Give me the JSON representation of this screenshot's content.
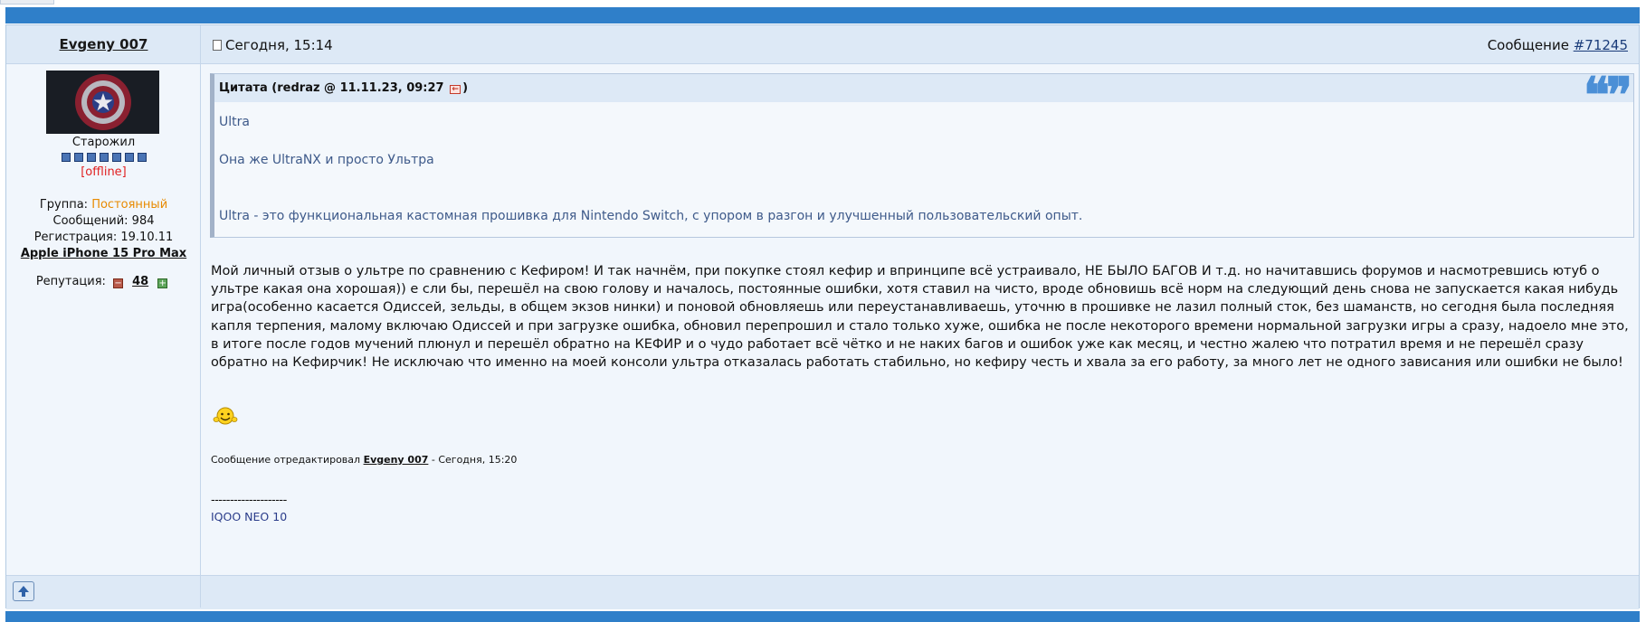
{
  "post": {
    "author": "Evgeny 007",
    "date": "Сегодня, 15:14",
    "post_prefix": "Сообщение ",
    "post_number": "#71245",
    "rank": "Старожил",
    "pip_count": 7,
    "status": "[offline]",
    "group_label": "Группа: ",
    "group_value": "Постоянный",
    "messages": "Сообщений: 984",
    "registration": "Регистрация: 19.10.11",
    "device": "Apple iPhone 15 Pro Max",
    "reputation_label": "Репутация:",
    "reputation_value": "48"
  },
  "quote": {
    "title_prefix": "Цитата (redraz @ 11.11.23, 09:27 ",
    "title_suffix": ")",
    "mark": "❝",
    "lines": [
      "Ultra",
      "Она же UltraNX и просто Ультра",
      "Ultra - это функциональная кастомная прошивка для Nintendo Switch, с упором в разгон и улучшенный пользовательский опыт."
    ]
  },
  "body_text": "Мой личный отзыв о ультре по сравнению с Кефиром! И так начнём, при покупке стоял кефир и впринципе всё устраивало, НЕ БЫЛО БАГОВ И т.д. но начитавшись форумов и насмотревшись ютуб о ультре какая она хорошая)) е сли бы, перешёл на свою голову и началось, постоянные ошибки, хотя ставил на чисто, вроде обновишь всё норм на следующий день снова не запускается какая нибудь игра(особенно касается Одиссей, зельды, в общем экзов нинки) и поновой обновляешь или переустанавливаешь, уточню в прошивке не лазил полный сток, без шаманств, но сегодня была последняя капля терпения, малому включаю Одиссей и при загрузке ошибка, обновил перепрошил и стало только хуже, ошибка не после некоторого времени нормальной загрузки игры а сразу, надоело мне это, в итоге после годов мучений плюнул и перешёл обратно на КЕФИР и о чудо работает всё чётко и не наких багов и ошибок уже как месяц, и честно жалею что потратил время и не перешёл сразу обратно на Кефирчик! Не исключаю что именно на моей консоли ультра отказалась работать стабильно, но кефиру честь и хвала за его работу, за много лет не одного зависания или ошибки не было!",
  "edit": {
    "prefix": "Сообщение отредактировал ",
    "editor": "Evgeny 007",
    "suffix": " - Сегодня, 15:20"
  },
  "signature": {
    "separator": "--------------------",
    "text": "IQOO NEO 10"
  },
  "colors": {
    "bar": "#2f7fc9",
    "header_bg": "#dde9f6",
    "post_bg": "#f1f6fc",
    "group": "#e88a00",
    "offline": "#e02020",
    "quote_text": "#3e5a8a",
    "quote_mark": "#4b8fd6"
  }
}
